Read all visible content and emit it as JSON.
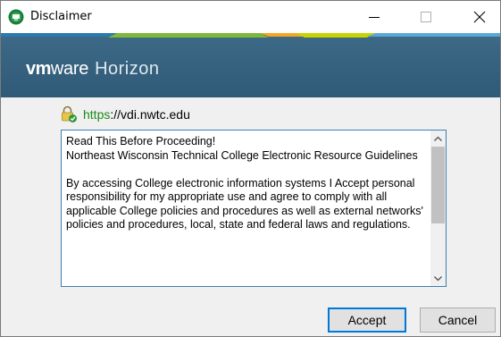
{
  "window": {
    "title": "Disclaimer"
  },
  "banner": {
    "logo_vm": "vm",
    "logo_ware": "ware",
    "product": "Horizon",
    "stripe_colors": [
      "#2a7ab0",
      "#7fb83a",
      "#f5a623",
      "#c8d400",
      "#5aa8d6"
    ]
  },
  "url": {
    "scheme": "https",
    "rest": "://vdi.nwtc.edu"
  },
  "disclaimer": {
    "text": "Read This Before Proceeding!\nNortheast Wisconsin Technical College Electronic Resource Guidelines\n\nBy accessing College electronic information systems I Accept personal responsibility for my appropriate use and agree to comply with all applicable College policies and procedures as well as external networks' policies and procedures, local, state and federal laws and regulations."
  },
  "buttons": {
    "accept": "Accept",
    "cancel": "Cancel"
  },
  "icons": {
    "app": "vmware-horizon-app-icon",
    "minimize": "minimize-icon",
    "maximize": "maximize-icon",
    "close": "close-icon",
    "lock": "lock-check-icon",
    "scroll_up": "chevron-up-icon",
    "scroll_down": "chevron-down-icon"
  },
  "colors": {
    "banner": "#35627f",
    "accent": "#0078d7",
    "secure": "#1a8a1a"
  }
}
